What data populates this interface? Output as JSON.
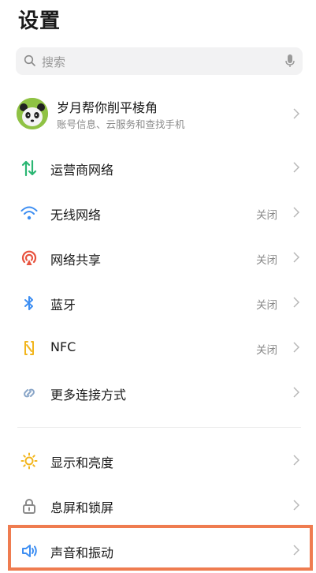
{
  "header": {
    "title": "设置"
  },
  "search": {
    "placeholder": "搜索"
  },
  "account": {
    "name": "岁月帮你削平棱角",
    "subtitle": "账号信息、云服务和查找手机"
  },
  "items": [
    {
      "label": "运营商网络",
      "status": ""
    },
    {
      "label": "无线网络",
      "status": "关闭"
    },
    {
      "label": "网络共享",
      "status": "关闭"
    },
    {
      "label": "蓝牙",
      "status": "关闭"
    },
    {
      "label": "NFC",
      "status": "关闭"
    },
    {
      "label": "更多连接方式",
      "status": ""
    },
    {
      "label": "显示和亮度",
      "status": ""
    },
    {
      "label": "息屏和锁屏",
      "status": ""
    },
    {
      "label": "声音和振动",
      "status": ""
    }
  ],
  "colors": {
    "highlight": "#ef7c50",
    "cellular": "#2bb673",
    "wifi": "#3d8ef2",
    "hotspot": "#e8533f",
    "bluetooth": "#3d8ef2",
    "nfc": "#f2b51c",
    "display": "#f2b51c",
    "sound": "#3d8ef2"
  }
}
